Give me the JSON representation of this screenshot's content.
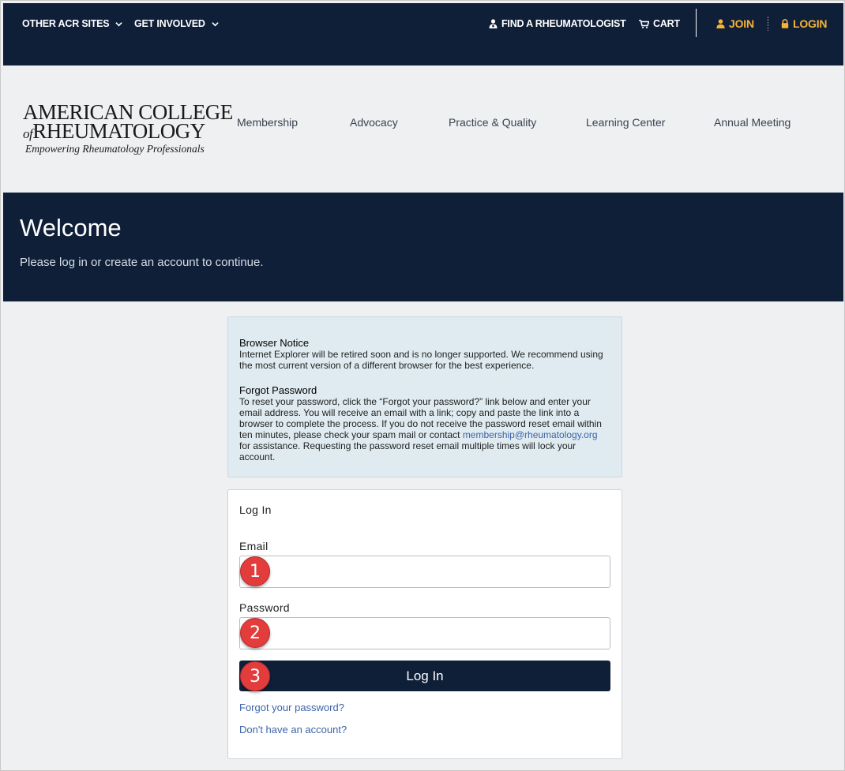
{
  "topbar": {
    "other_sites": "OTHER ACR SITES",
    "get_involved": "GET INVOLVED",
    "find_rheum": "FIND A RHEUMATOLOGIST",
    "cart": "CART",
    "join": "JOIN",
    "login": "LOGIN"
  },
  "logo": {
    "line1": "AMERICAN COLLEGE",
    "of": "of",
    "line2": "RHEUMATOLOGY",
    "tagline": "Empowering Rheumatology Professionals"
  },
  "nav": {
    "items": [
      "Membership",
      "Advocacy",
      "Practice & Quality",
      "Learning Center",
      "Annual Meeting"
    ]
  },
  "banner": {
    "title": "Welcome",
    "subtitle": "Please log in or create an account to continue."
  },
  "notice": {
    "browser_heading": "Browser Notice",
    "browser_text": "Internet Explorer will be retired soon and is no longer supported. We recommend using the most current version of a different browser for the best experience.",
    "forgot_heading": "Forgot Password",
    "forgot_text_before": "To reset your password, click the “Forgot your password?” link below and enter your email address. You will receive an email with a link; copy and paste the link into a browser to complete the process. If you do not receive the password reset email within ten minutes, please check your spam mail or contact",
    "email_link": "membership@rheumatology.org",
    "forgot_text_after": "for assistance. Requesting the password reset email multiple times will lock your account."
  },
  "login": {
    "heading": "Log In",
    "email_label": "Email",
    "email_value": "",
    "password_label": "Password",
    "password_value": "",
    "button": "Log In",
    "forgot_link": "Forgot your password?",
    "no_account_link": "Don't have an account?"
  },
  "callouts": [
    "1",
    "2",
    "3"
  ],
  "colors": {
    "navy": "#0f1f38",
    "gold": "#f5b335",
    "notice_bg": "#dfebf0",
    "link": "#3d63a8",
    "callout_red": "#e23c3c"
  },
  "icons": {
    "chevron": "chevron-down-icon",
    "find": "doctor-icon",
    "cart": "cart-icon",
    "join": "user-icon",
    "login": "lock-icon"
  }
}
